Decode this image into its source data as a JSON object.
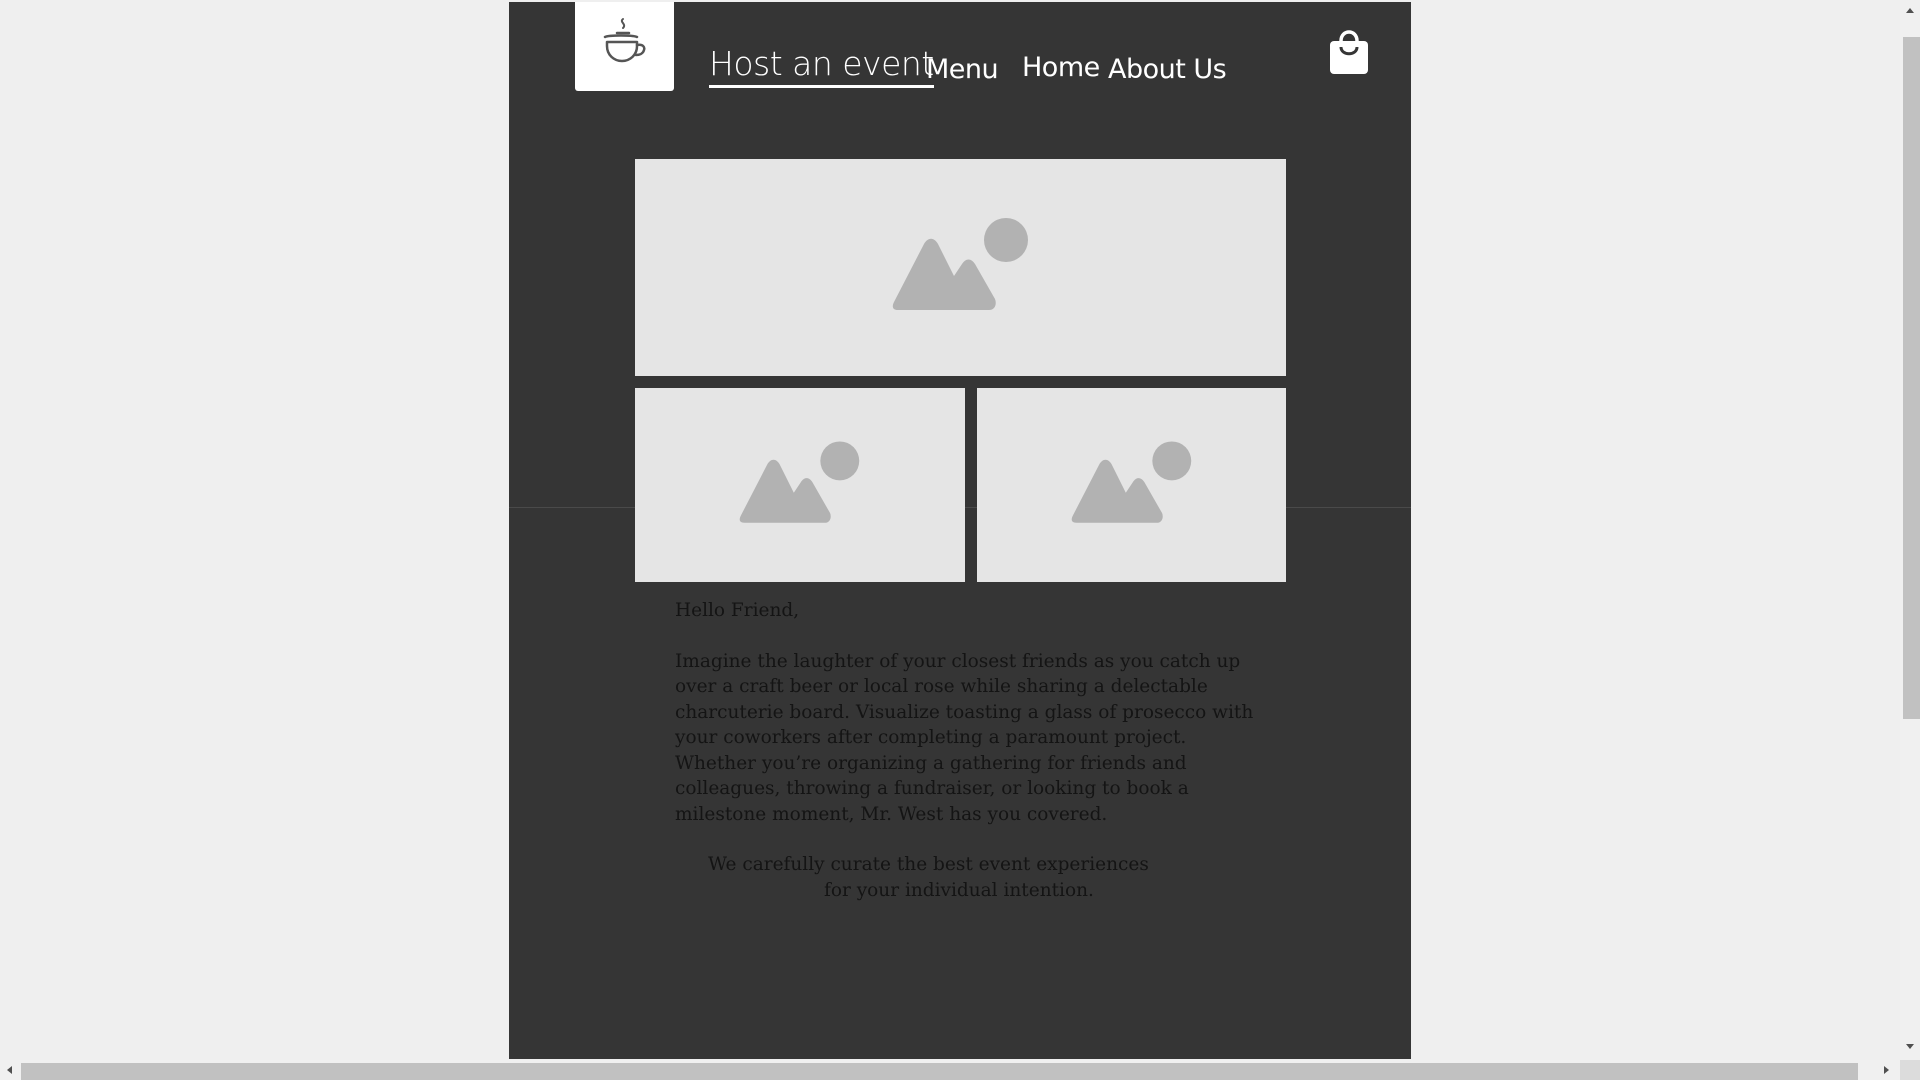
{
  "header": {
    "logo_icon": "coffee-cup-icon",
    "nav": [
      {
        "label": "Host an event",
        "active": true
      },
      {
        "label": "Menu",
        "active": false
      },
      {
        "label": "Home",
        "active": false
      },
      {
        "label": "About Us",
        "active": false
      }
    ],
    "cart_icon": "shopping-bag-icon"
  },
  "gallery": {
    "placeholder_icon": "image-placeholder-icon"
  },
  "content": {
    "greeting": "Hello Friend,",
    "paragraph": "Imagine the laughter of your closest friends as you catch up over a craft beer or local rose while sharing a delectable charcuterie board. Visualize toasting a glass of prosecco with your coworkers after completing a paramount project. Whether you’re organizing a gathering for friends and colleagues, throwing a fundraiser, or looking to book a milestone moment, Mr. West has you covered.",
    "tagline_line1": "We carefully curate the best event experiences",
    "tagline_line2": "for your individual intention."
  },
  "colors": {
    "page_bg": "#353535",
    "outer_bg": "#efefef",
    "placeholder_bg": "#e5e5e5",
    "placeholder_icon": "#b2b2b2",
    "text": "#141414"
  }
}
